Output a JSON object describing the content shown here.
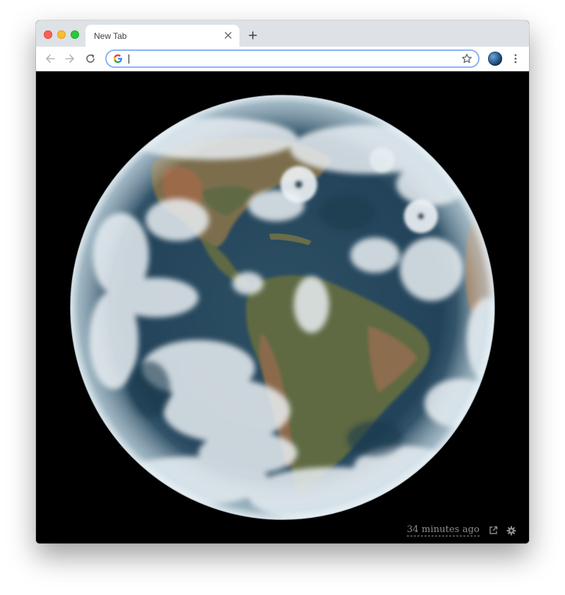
{
  "browser": {
    "tabs": [
      {
        "title": "New Tab",
        "active": true
      }
    ],
    "omnibox": {
      "value": "",
      "placeholder": ""
    },
    "icons": {
      "back": "arrow-left-icon",
      "forward": "arrow-right-icon",
      "reload": "reload-icon",
      "bookmark": "star-icon",
      "menu": "kebab-menu-icon",
      "new_tab": "plus-icon",
      "close_tab": "close-icon",
      "search_engine": "google-g-icon"
    }
  },
  "page": {
    "image": "earth-full-disk-satellite",
    "last_updated": "34 minutes ago",
    "icons": {
      "open": "external-link-icon",
      "settings": "gear-icon"
    }
  },
  "colors": {
    "tabstrip": "#dee1e6",
    "omnibox_focus": "#8ab4f8",
    "page_background": "#000000",
    "footer_text": "#8e8e8e"
  }
}
